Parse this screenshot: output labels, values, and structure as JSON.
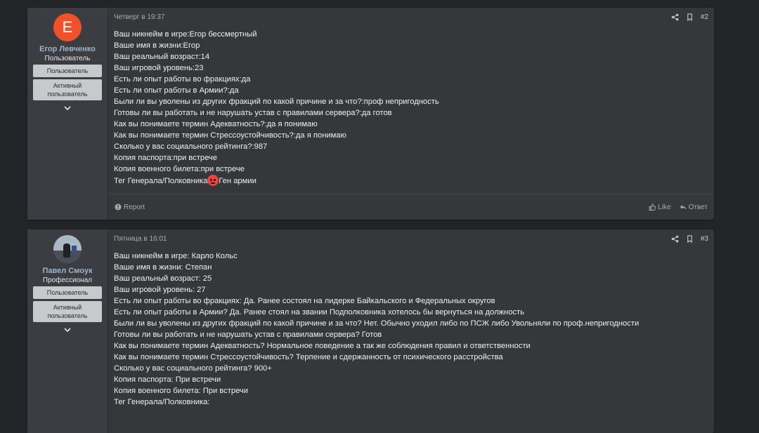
{
  "posts": [
    {
      "user": {
        "avatar_letter": "Е",
        "avatar_color": "#f0512b",
        "name": "Егор Левченко",
        "title": "Пользователь",
        "banners": [
          "Пользователь",
          "Активный пользователь"
        ]
      },
      "date": "Четверг в 19:37",
      "number": "#2",
      "lines": [
        "Ваш никнейм в игре:Егор бессмертный",
        "Ваше имя в жизни:Егор",
        "Ваш реальный возраст:14",
        "Ваш игровой уровень:23",
        "Есть ли опыт работы во фракциях:да",
        "Есть ли опыт работы в Армии?:да",
        "Были ли вы уволены из других фракций по какой причине и за что?:проф непригодность",
        "Готовы ли вы работать и не нарушать устав с правилами сервера?:да готов",
        "Как вы понимаете термин Адекватность?:да я понимаю",
        "Как вы понимаете термин Стрессоустойчивость?:да я понимаю",
        "Сколько у вас социального рейтинга?:987",
        "Копия паспорта:при встрече",
        "Копия военного билета:при встрече"
      ],
      "last_line_before": "Тег Генерала/Полковника",
      "last_line_emoji": "angry-face-emoji",
      "last_line_after": "Ген армии",
      "footer": {
        "report": "Report",
        "like": "Like",
        "reply": "Ответ"
      }
    },
    {
      "user": {
        "name": "Павел Смоук",
        "title": "Профессионал",
        "banners": [
          "Пользователь",
          "Активный пользователь"
        ]
      },
      "date": "Пятница в 16:01",
      "number": "#3",
      "lines": [
        "Ваш никнейм в игре: Карло Кольс",
        "Ваше имя в жизни: Степан",
        "Ваш реальный возраст: 25",
        "Ваш игровой уровень: 27",
        "Есть ли опыт работы во фракциях: Да. Ранее состоял на лидерке Байкальского и Федеральных округов",
        "Есть ли опыт работы в Армии? Да. Ранее стоял на звании Подполковника хотелось бы вернуться на должность",
        "Были ли вы уволены из других фракций по какой причине и за что? Нет. Обычно уходил либо по ПСЖ либо Увольняли по проф.непригодности",
        "Готовы ли вы работать и не нарушать устав с правилами сервера? Готов",
        "Как вы понимаете термин Адекватность? Нормальное поведение а так же соблюдения правил и ответственности",
        "Как вы понимаете термин Стрессоустойчивость? Терпение и сдержанность от психического расстройства",
        "Сколько у вас социального рейтинга? 900+",
        "Копия паспорта: При встречи",
        "Копия военного билета: При встречи",
        "Тег Генерала/Полковника:"
      ]
    }
  ]
}
